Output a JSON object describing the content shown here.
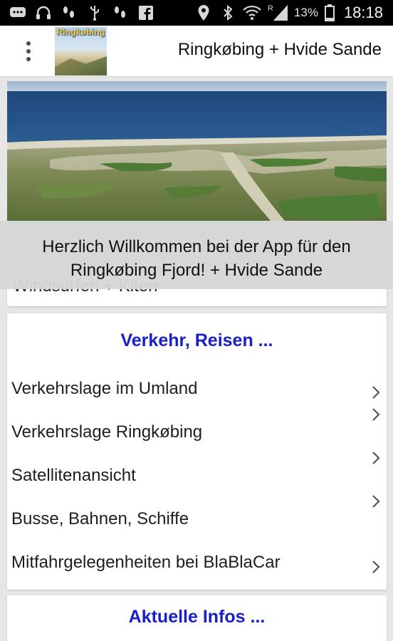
{
  "status_bar": {
    "icons_left": [
      "messenger-icon",
      "headset-icon",
      "footprints-icon",
      "usb-icon",
      "footprints-icon",
      "facebook-icon"
    ],
    "icons_right": [
      "location-icon",
      "bluetooth-icon",
      "wifi-icon",
      "signal-icon"
    ],
    "roaming": "R",
    "battery_percent": "13%",
    "time": "18:18"
  },
  "app_bar": {
    "logo_text": "Ringkøbing",
    "title": "Ringkøbing + Hvide Sande"
  },
  "banner": {
    "welcome_text": "Herzlich Willkommen bei der App für den Ringkøbing Fjord! + Hvide Sande"
  },
  "sections": {
    "partial_item": "Windsurfen + Kiten",
    "verkehr": {
      "heading": "Verkehr, Reisen ...",
      "items": [
        {
          "label": "Verkehrslage im Umland"
        },
        {
          "label": "Verkehrslage Ringkøbing"
        },
        {
          "label": "Satellitenansicht"
        },
        {
          "label": "Busse, Bahnen, Schiffe"
        },
        {
          "label": "Mitfahrgelegenheiten bei BlaBlaCar"
        }
      ]
    },
    "infos": {
      "heading": "Aktuelle Infos ..."
    }
  },
  "colors": {
    "heading_blue": "#1a20c8",
    "status_bar_bg": "#000000",
    "welcome_overlay": "#d6d6d6"
  }
}
